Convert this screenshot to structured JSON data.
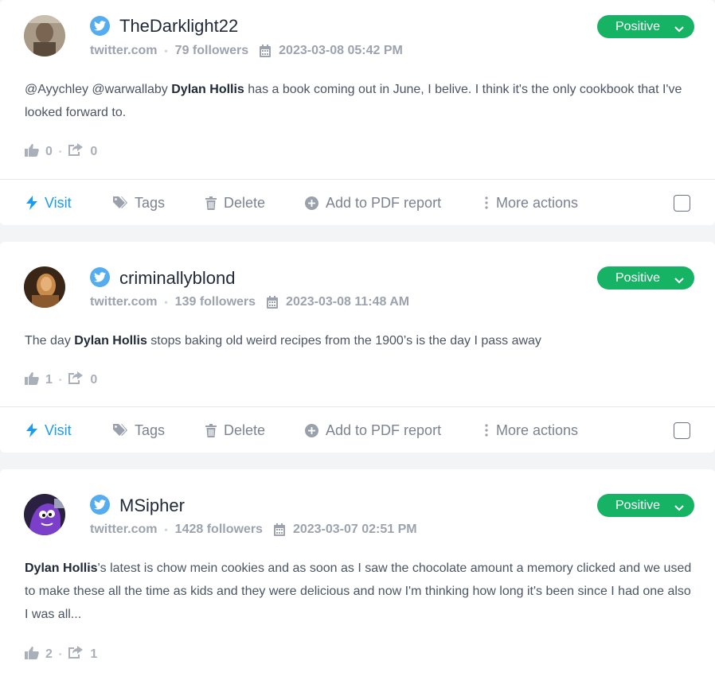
{
  "posts": [
    {
      "author": "TheDarklight22",
      "source": "twitter.com",
      "followers": "79 followers",
      "datetime": "2023-03-08 05:42 PM",
      "sentiment": "Positive",
      "text_before": "@Ayychley @warwallaby ",
      "text_highlight": "Dylan Hollis",
      "text_after": " has a book coming out in June, I belive. I think it's the only cookbook that I've looked forward to.",
      "likes": "0",
      "shares": "0"
    },
    {
      "author": "criminallyblond",
      "source": "twitter.com",
      "followers": "139 followers",
      "datetime": "2023-03-08 11:48 AM",
      "sentiment": "Positive",
      "text_before": "The day ",
      "text_highlight": "Dylan Hollis",
      "text_after": " stops baking old weird recipes from the 1900’s is the day I pass away",
      "likes": "1",
      "shares": "0"
    },
    {
      "author": "MSipher",
      "source": "twitter.com",
      "followers": "1428 followers",
      "datetime": "2023-03-07 02:51 PM",
      "sentiment": "Positive",
      "text_before": "",
      "text_highlight": "Dylan Hollis",
      "text_after": "'s latest is chow mein cookies and as soon as I saw the chocolate amount a memory clicked and we used to make these all the time as kids and they were delicious and now I'm thinking how long it's been since I had one also I was all...",
      "likes": "2",
      "shares": "1"
    }
  ],
  "actions": {
    "visit": "Visit",
    "tags": "Tags",
    "delete": "Delete",
    "add_pdf": "Add to PDF report",
    "more": "More actions"
  },
  "separator": "•",
  "colors": {
    "twitter": "#55acee",
    "positive": "#16b364",
    "visit": "#1a9cf0",
    "muted": "#9ca3af"
  },
  "icons": [
    "twitter-icon",
    "calendar-icon",
    "chevron-down-icon",
    "thumbs-up-icon",
    "share-icon",
    "bolt-icon",
    "tag-icon",
    "trash-icon",
    "plus-circle-icon",
    "vertical-dots-icon"
  ]
}
